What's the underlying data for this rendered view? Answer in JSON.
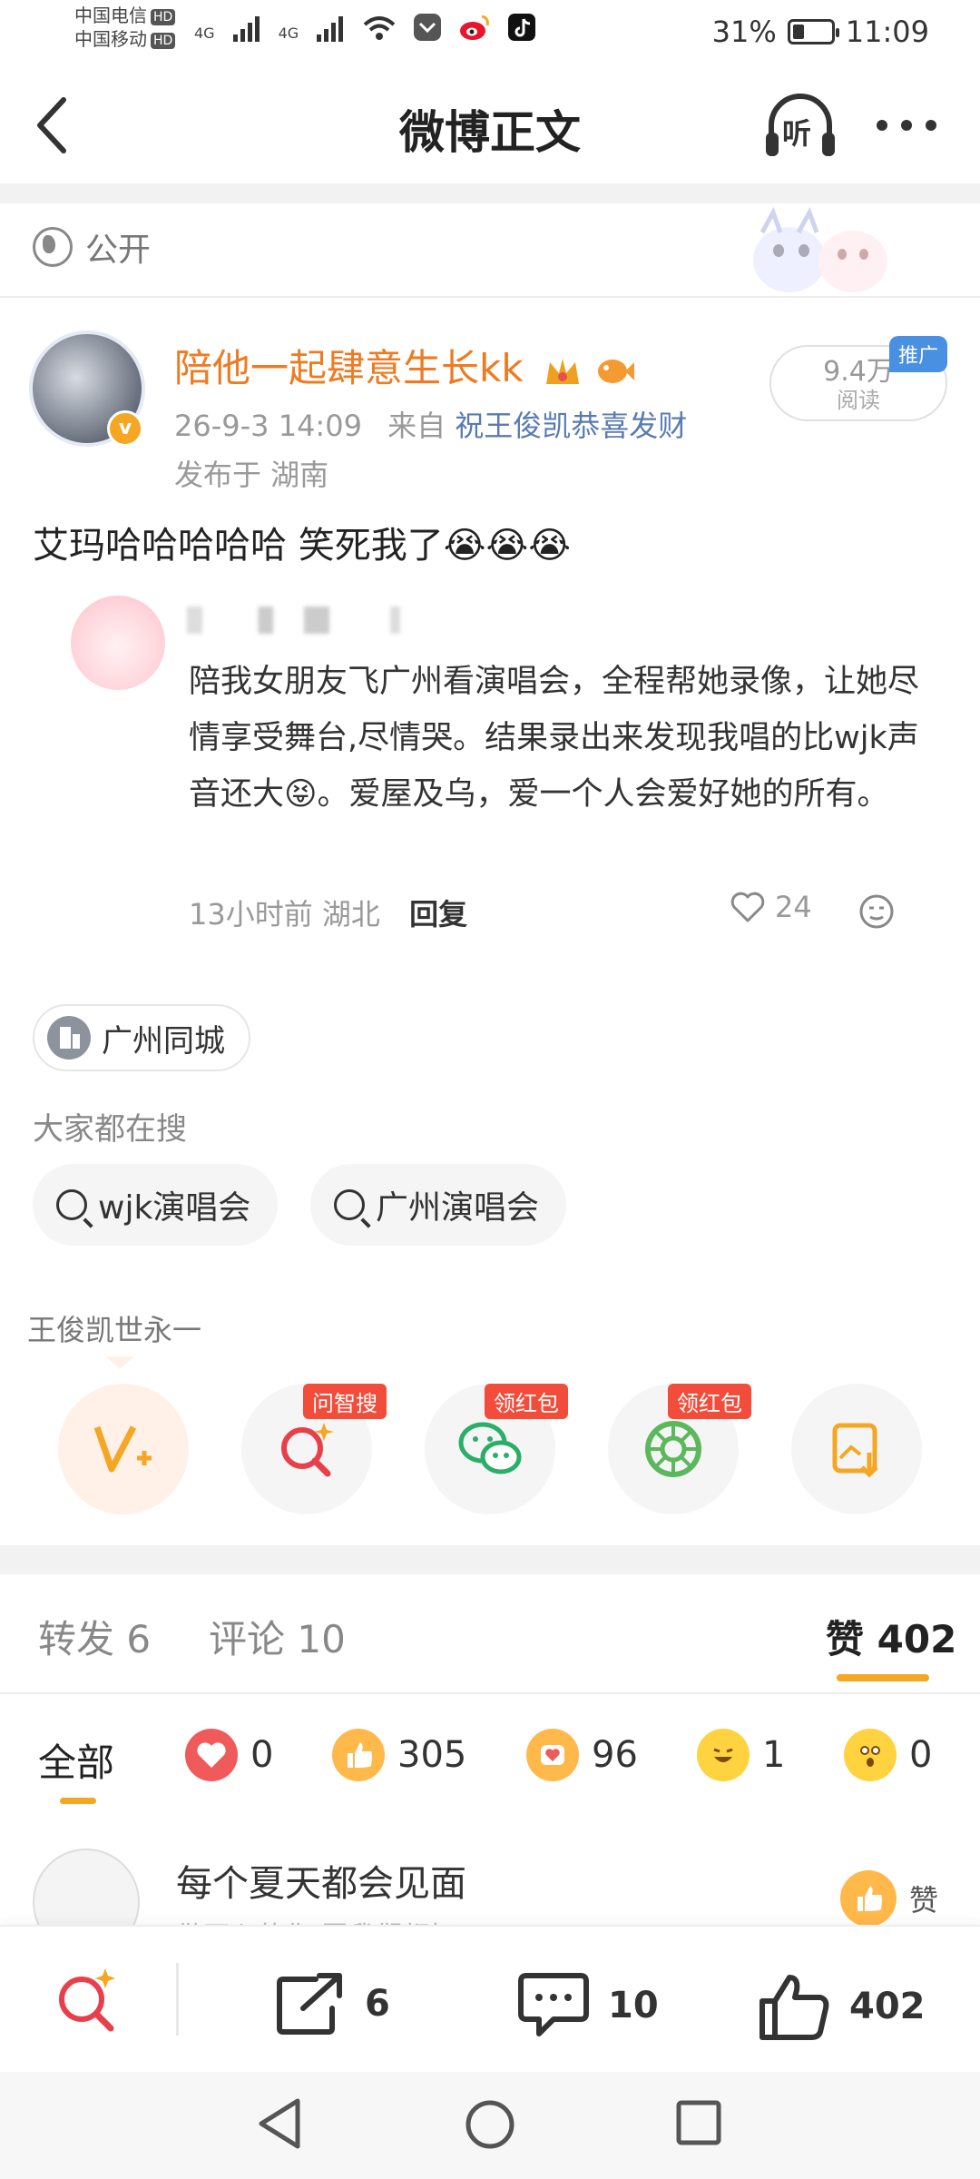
{
  "status_bar": {
    "carrier1": "中国电信",
    "carrier2": "中国移动",
    "hd": "HD",
    "net": "4G",
    "battery": "31%",
    "battery_fill": 0.31,
    "time": "11:09"
  },
  "header": {
    "title": "微博正文",
    "listen": "听"
  },
  "visibility": "公开",
  "post": {
    "author": "陪他一起肆意生长kk",
    "date": "26-9-3 14:09",
    "from_prefix": "来自",
    "source": "祝王俊凯恭喜发财",
    "location": "发布于 湖南",
    "views_count": "9.4万",
    "views_label": "阅读",
    "promo": "推广",
    "text": "艾玛哈哈哈哈哈 笑死我了😭😭😭"
  },
  "quoted_comment": {
    "text": "陪我女朋友飞广州看演唱会，全程帮她录像，让她尽情享受舞台,尽情哭。结果录出来发现我唱的比wjk声音还大😝。爱屋及乌，爱一个人会爱好她的所有。",
    "time_loc": "13小时前 湖北",
    "reply": "回复",
    "likes": "24"
  },
  "city_tag": "广州同城",
  "search_section": {
    "label": "大家都在搜",
    "pills": [
      "wjk演唱会",
      "广州演唱会"
    ]
  },
  "ticker": "王俊凯世永一",
  "share_badges": {
    "ask": "问智搜",
    "red1": "领红包",
    "red2": "领红包"
  },
  "tabs": {
    "repost_label": "转发",
    "repost_count": "6",
    "comment_label": "评论",
    "comment_count": "10",
    "like_label": "赞",
    "like_count": "402"
  },
  "reactions": {
    "all": "全部",
    "items": [
      "0",
      "305",
      "96",
      "1",
      "0"
    ]
  },
  "liker": {
    "name": "每个夏天都会见面",
    "sub": "做开心的你 愿我们都好",
    "action": "赞"
  },
  "actionbar": {
    "repost": "6",
    "comment": "10",
    "like": "402"
  },
  "colors": {
    "accent": "#f5a623",
    "author": "#ee7b22",
    "badge_red": "#f24c3a"
  }
}
